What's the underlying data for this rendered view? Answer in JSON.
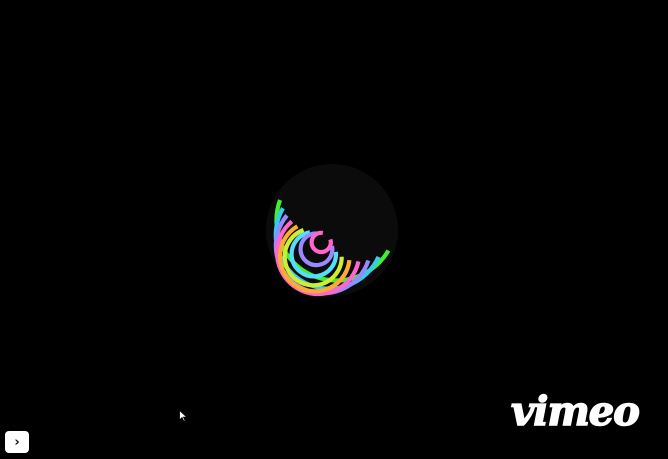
{
  "player": {
    "state": "loading",
    "background_color": "#000000"
  },
  "spinner": {
    "icon": "loading-spinner-icon",
    "ring_colors": [
      "#44ee33",
      "#33ccee",
      "#9988ff",
      "#ff66cc",
      "#ffaa33",
      "#ccee33",
      "#55ddff",
      "#9988ff",
      "#ff66cc"
    ]
  },
  "cursor": {
    "icon": "mouse-pointer-icon"
  },
  "expand_button": {
    "icon": "chevron-right-icon",
    "label": "›"
  },
  "logo": {
    "brand": "vimeo",
    "color": "#ffffff"
  }
}
